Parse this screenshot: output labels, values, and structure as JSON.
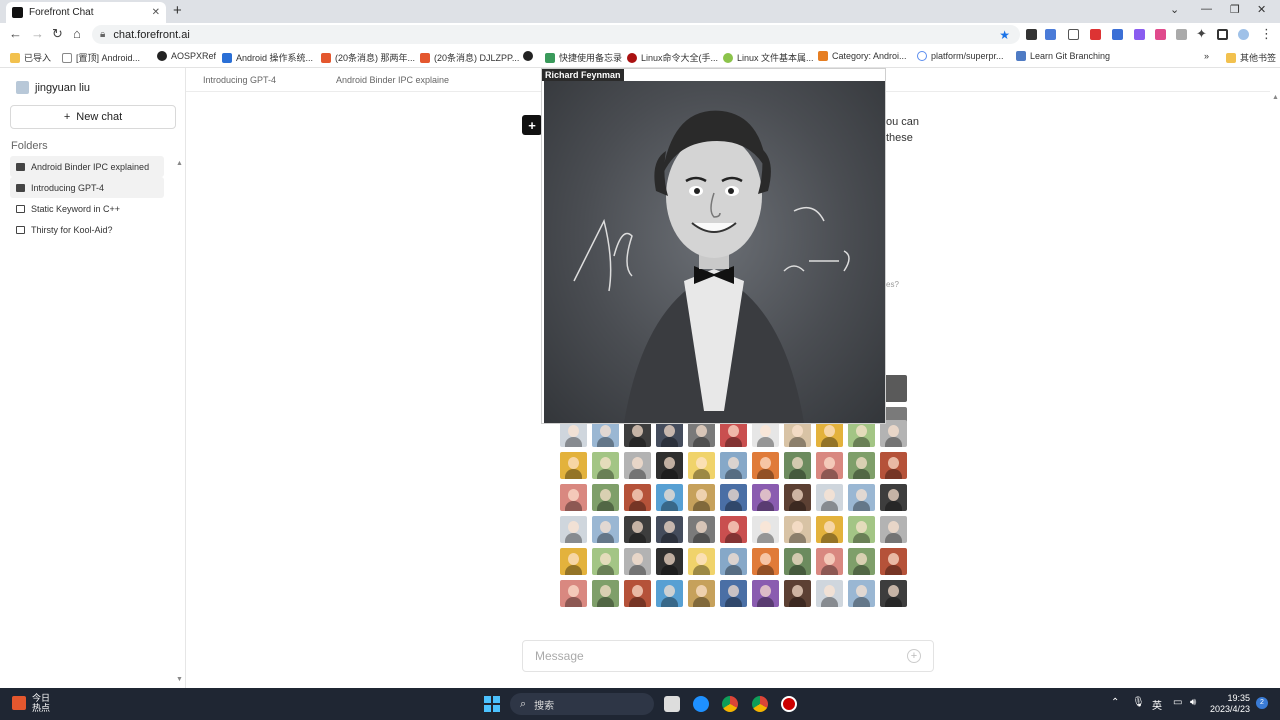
{
  "browser": {
    "tab_title": "Forefront Chat",
    "url": "chat.forefront.ai",
    "bookmarks": [
      "已导入",
      "[置顶] Android...",
      "AOSPXRef",
      "Android 操作系统...",
      "(20条消息) 那两年...",
      "(20条消息) DJLZPP...",
      "快捷使用备忘录",
      "Linux命令大全(手...",
      "Linux 文件基本属...",
      "Category: Androi...",
      "platform/superpr...",
      "Learn Git Branching",
      "其他书签"
    ]
  },
  "sidebar": {
    "user_name": "jingyuan liu",
    "new_chat_label": "New chat",
    "folders_label": "Folders",
    "conversations": [
      "Android Binder IPC explained",
      "Introducing GPT-4",
      "Static Keyword in C++",
      "Thirsty for Kool-Aid?"
    ]
  },
  "main": {
    "tabs": [
      "Introducing GPT-4",
      "Android Binder IPC explaine"
    ],
    "bg_text_1": "ou can",
    "bg_text_2": "these",
    "bg_text_3": "es?",
    "popup_label": "Richard Feynman",
    "message_placeholder": "Message"
  },
  "taskbar": {
    "weather_line1": "今日",
    "weather_line2": "热点",
    "search_label": "搜索",
    "ime": "英",
    "time": "19:35",
    "date": "2023/4/23"
  },
  "colors": {
    "accent": "#1a73e8",
    "taskbar": "#1f2633"
  }
}
